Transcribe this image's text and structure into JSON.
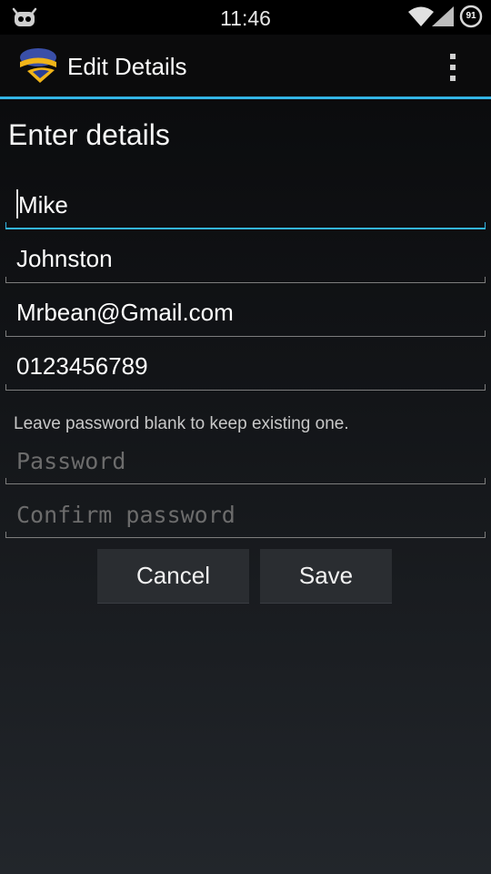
{
  "status_bar": {
    "time": "11:46",
    "battery_level": "91",
    "icons": [
      "android-notification-icon",
      "wifi-icon",
      "signal-icon",
      "battery-icon"
    ]
  },
  "action_bar": {
    "title": "Edit Details",
    "logo_icon": "app-logo-icon",
    "overflow_icon": "overflow-menu-icon"
  },
  "form": {
    "heading": "Enter details",
    "first_name": "Mike",
    "last_name": "Johnston",
    "email": "Mrbean@Gmail.com",
    "phone": "0123456789",
    "password_hint": "Leave password blank to keep existing one.",
    "password_placeholder": "Password",
    "confirm_password_placeholder": "Confirm password",
    "cancel_label": "Cancel",
    "save_label": "Save"
  },
  "colors": {
    "accent": "#33b5e5",
    "background": "#0b0c0e",
    "button": "#2a2d31"
  }
}
